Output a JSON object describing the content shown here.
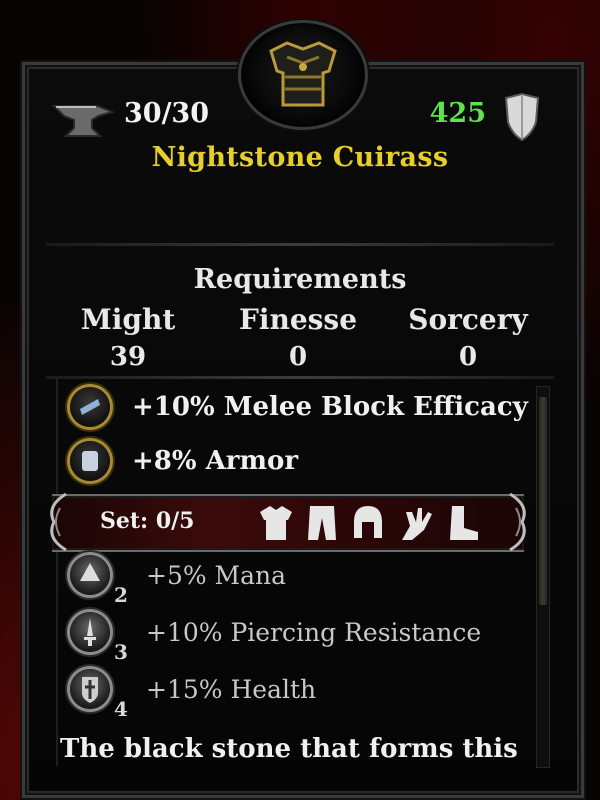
{
  "item": {
    "name": "Nightstone Cuirass",
    "durability": "30/30",
    "armor_value": "425",
    "icon": "chest-armor-icon",
    "colors": {
      "name": "#e6cf2a",
      "armor_value": "#5fe24b"
    }
  },
  "requirements": {
    "title": "Requirements",
    "stats": [
      {
        "label": "Might",
        "value": "39"
      },
      {
        "label": "Finesse",
        "value": "0"
      },
      {
        "label": "Sorcery",
        "value": "0"
      }
    ]
  },
  "bonuses": [
    {
      "text": "+10% Melee Block Efficacy",
      "icon": "shield-block-icon"
    },
    {
      "text": "+8% Armor",
      "icon": "armor-bonus-icon"
    }
  ],
  "set": {
    "label": "Set: 0/5",
    "pieces": [
      "chest-icon",
      "legs-icon",
      "helm-icon",
      "gloves-icon",
      "boots-icon"
    ],
    "bonuses": [
      {
        "text": "+5% Mana",
        "tier": "2",
        "icon": "mana-orb-icon"
      },
      {
        "text": "+10% Piercing Resistance",
        "tier": "3",
        "icon": "dagger-icon"
      },
      {
        "text": "+15% Health",
        "tier": "4",
        "icon": "cross-shield-icon"
      }
    ]
  },
  "description": "The black stone that forms this"
}
